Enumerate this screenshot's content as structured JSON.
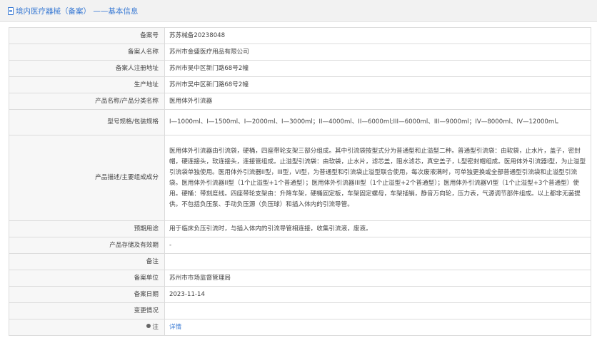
{
  "header": {
    "title": "境内医疗器械（备案） ——基本信息",
    "accent_color": "#3b7bd4"
  },
  "rows": [
    {
      "label": "备案号",
      "value": "苏苏械备20238048"
    },
    {
      "label": "备案人名称",
      "value": "苏州市金盛医疗用品有限公司"
    },
    {
      "label": "备案人注册地址",
      "value": "苏州市吴中区新门路68号2幢"
    },
    {
      "label": "生产地址",
      "value": "苏州市吴中区新门路68号2幢"
    },
    {
      "label": "产品名称/产品分类名称",
      "value": "医用体外引流器"
    },
    {
      "label": "型号规格/包装规格",
      "value": "I—1000ml、I—1500ml、I—2000ml、I—3000ml；II—4000ml、II—6000ml;III—6000ml、III—9000ml；IV—8000ml、IV—12000ml。"
    },
    {
      "label": "产品描述/主要组成成分",
      "value": "医用体外引流器由引流袋，硬桶，四座带轮支架三部分组成。其中引流袋按型式分为普通型和止溢型二种。普通型引流袋：由软袋，止水片，盖子，密封帽，硬连接头，软连接头，连接管组成。止溢型引流袋：由软袋，止水片，滤芯盖，阻水滤芯，真空盖子，L型密封帽组成。医用体外引流器I型，为止溢型引流袋单独使用。医用体外引流器II型，III型，VI型，为普通型和引流袋止溢型联合使用，每次废液满时，可单独更换或全部普通型引流袋和止溢型引流袋。医用体外引流器II型（1个止溢型+1个普通型）；医用体外引流器III型（1个止溢型+2个普通型）；医用体外引流器VI型（1个止溢型+3个普通型）使用。硬桶：带刻度线。四座带轮支架由：升降车架，硬桶固定板，车架固定螺母，车架插销，静音万向轮，压力表，气源调节部件组成。以上都非无菌提供。不包括负压泵、手动负压源（负压球）和插入体内的引流导管。"
    },
    {
      "label": "预期用途",
      "value": "用于临床负压引流时，与插入体内的引流导管相连接，收集引流液，废液。"
    },
    {
      "label": "产品存储及有效期",
      "value": "-"
    },
    {
      "label": "备注",
      "value": ""
    },
    {
      "label": "备案单位",
      "value": "苏州市市场监督管理局"
    },
    {
      "label": "备案日期",
      "value": "2023-11-14"
    },
    {
      "label": "变更情况",
      "value": ""
    },
    {
      "label": "注",
      "value": "详情",
      "icon": "info-dot-icon"
    }
  ]
}
